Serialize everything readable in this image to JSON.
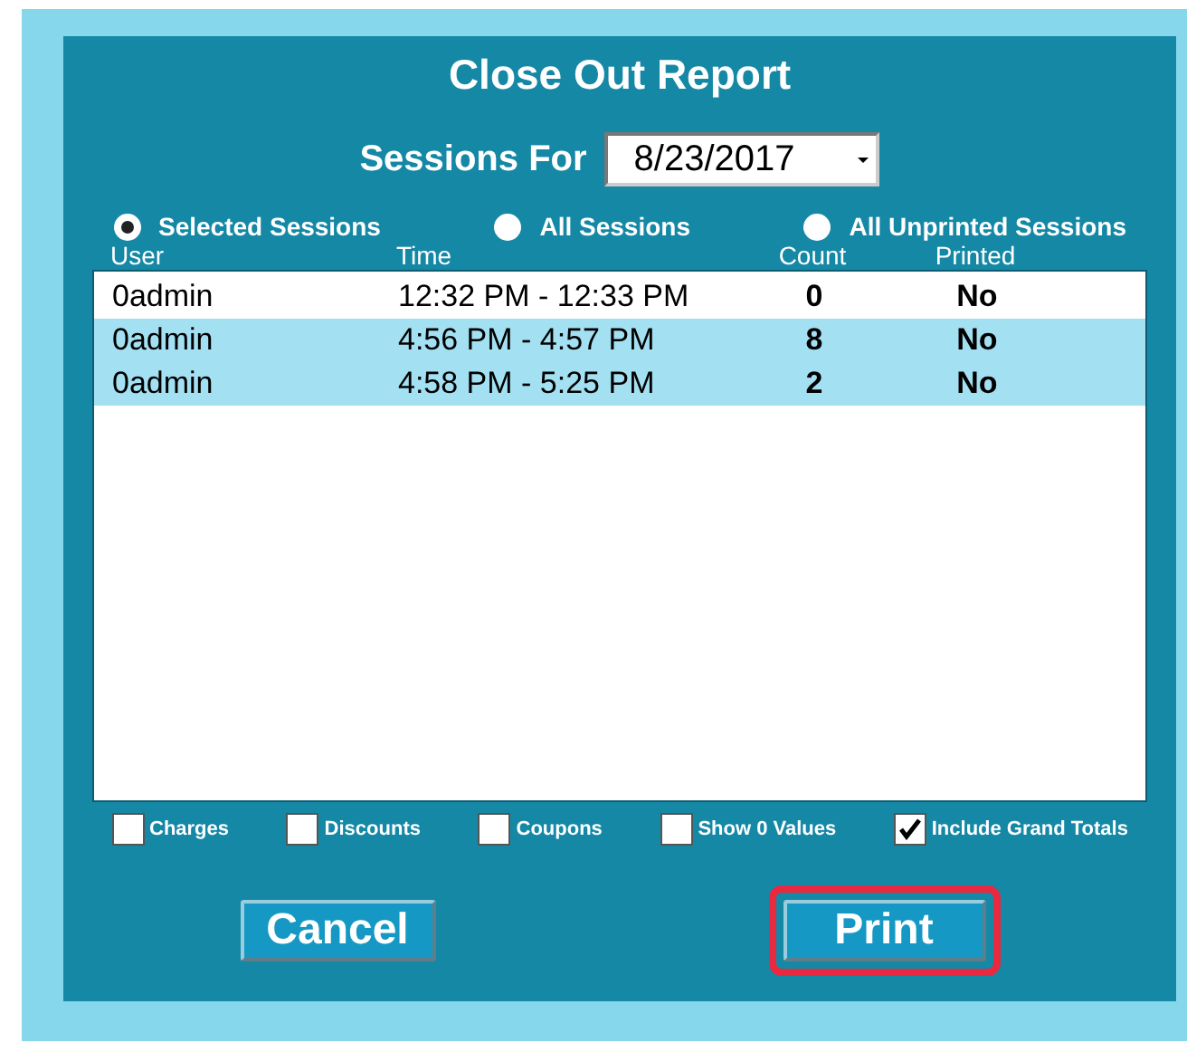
{
  "window": {
    "title": "Close Out Report"
  },
  "date_picker": {
    "label": "Sessions For",
    "value": "8/23/2017"
  },
  "scope_options": [
    {
      "label": "Selected Sessions",
      "selected": true
    },
    {
      "label": "All Sessions",
      "selected": false
    },
    {
      "label": "All Unprinted Sessions",
      "selected": false
    }
  ],
  "table": {
    "columns": [
      "User",
      "Time",
      "Count",
      "Printed"
    ],
    "rows": [
      {
        "cells": [
          "0admin",
          "12:32 PM - 12:33 PM",
          "0",
          "No"
        ],
        "selected": false
      },
      {
        "cells": [
          "0admin",
          "4:56 PM - 4:57 PM",
          "8",
          "No"
        ],
        "selected": true
      },
      {
        "cells": [
          "0admin",
          "4:58 PM - 5:25 PM",
          "2",
          "No"
        ],
        "selected": true
      }
    ]
  },
  "options": [
    {
      "label": "Charges",
      "checked": false
    },
    {
      "label": "Discounts",
      "checked": false
    },
    {
      "label": "Coupons",
      "checked": false
    },
    {
      "label": "Show 0 Values",
      "checked": false
    },
    {
      "label": "Include Grand Totals",
      "checked": true
    }
  ],
  "buttons": [
    {
      "label": "Cancel",
      "highlighted": false
    },
    {
      "label": "Print",
      "highlighted": true
    }
  ]
}
